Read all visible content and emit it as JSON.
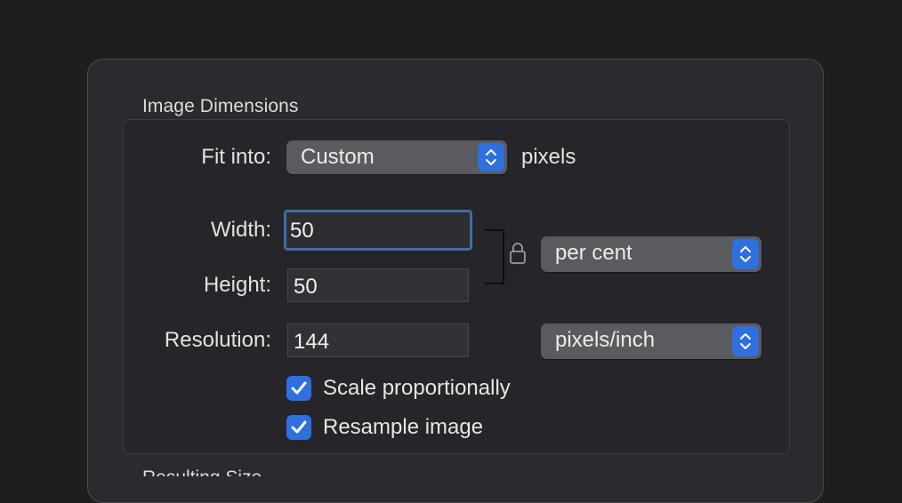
{
  "sections": {
    "image_dimensions_title": "Image Dimensions",
    "next_section_title_partial": "Resulting Size"
  },
  "fit_into": {
    "label": "Fit into:",
    "selected": "Custom",
    "unit": "pixels"
  },
  "width": {
    "label": "Width:",
    "value": "50"
  },
  "height": {
    "label": "Height:",
    "value": "50"
  },
  "resolution": {
    "label": "Resolution:",
    "value": "144"
  },
  "size_unit": {
    "selected": "per cent"
  },
  "resolution_unit": {
    "selected": "pixels/inch"
  },
  "options": {
    "scale_proportionally": {
      "label": "Scale proportionally",
      "checked": true
    },
    "resample_image": {
      "label": "Resample image",
      "checked": true
    }
  },
  "colors": {
    "accent": "#2f6fde",
    "focus_ring": "#3f6ea3",
    "background": "#1e1e1e",
    "panel": "#2b2a2f"
  },
  "icons": {
    "lock": "lock-icon",
    "stepper": "chevron-up-down-icon",
    "check": "checkmark-icon"
  }
}
